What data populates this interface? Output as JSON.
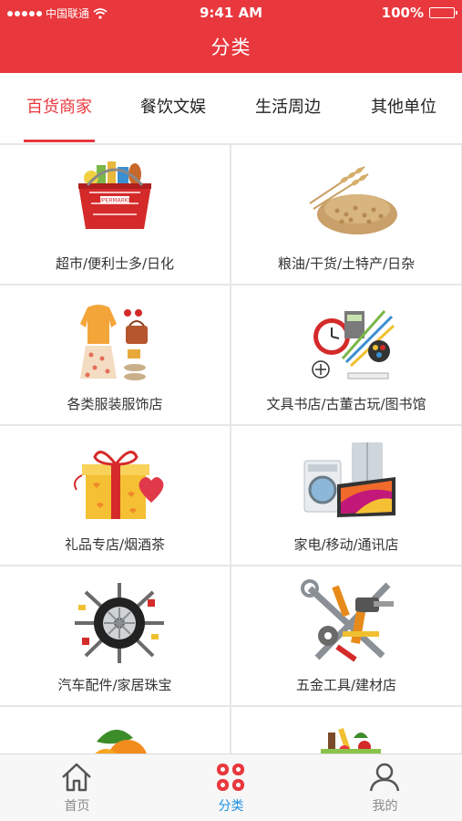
{
  "status_bar": {
    "carrier": "中国联通",
    "time": "9:41 AM",
    "battery": "100%"
  },
  "header": {
    "title": "分类"
  },
  "tabs": [
    {
      "label": "百货商家",
      "active": true
    },
    {
      "label": "餐饮文娱",
      "active": false
    },
    {
      "label": "生活周边",
      "active": false
    },
    {
      "label": "其他单位",
      "active": false
    }
  ],
  "categories": [
    {
      "label": "超市/便利士多/日化",
      "icon": "supermarket-basket-icon"
    },
    {
      "label": "粮油/干货/土特产/日杂",
      "icon": "wheat-grain-icon"
    },
    {
      "label": "各类服装服饰店",
      "icon": "clothing-icon"
    },
    {
      "label": "文具书店/古董古玩/图书馆",
      "icon": "stationery-icon"
    },
    {
      "label": "礼品专店/烟酒茶",
      "icon": "gift-box-icon"
    },
    {
      "label": "家电/移动/通讯店",
      "icon": "appliances-icon"
    },
    {
      "label": "汽车配件/家居珠宝",
      "icon": "car-parts-icon"
    },
    {
      "label": "五金工具/建材店",
      "icon": "tools-icon"
    },
    {
      "label": "",
      "icon": "fruit-icon"
    },
    {
      "label": "",
      "icon": "grocery-bag-icon"
    }
  ],
  "bottom_nav": [
    {
      "label": "首页",
      "icon": "home-icon",
      "active": false
    },
    {
      "label": "分类",
      "icon": "category-icon",
      "active": true
    },
    {
      "label": "我的",
      "icon": "profile-icon",
      "active": false
    }
  ],
  "colors": {
    "brand_red": "#e8383d",
    "active_blue": "#1a8fe0",
    "nav_gray": "#8a8a8a"
  }
}
